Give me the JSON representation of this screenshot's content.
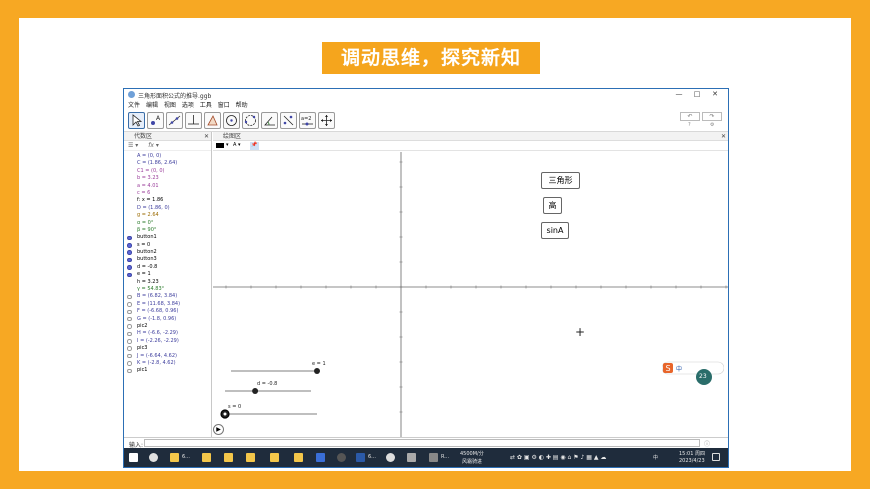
{
  "slide": {
    "title": "调动思维，探究新知"
  },
  "window": {
    "title": "三角形面积公式的推导.ggb",
    "controls": [
      "—",
      "□",
      "✕"
    ]
  },
  "menu": [
    "文件",
    "编辑",
    "视图",
    "选项",
    "工具",
    "窗口",
    "帮助"
  ],
  "algebra": {
    "header": "代数区",
    "fx": "fx",
    "items": [
      {
        "text": "A = (0, 0)",
        "color": "#3c3c9c",
        "dot": "none"
      },
      {
        "text": "C = (1.86, 2.64)",
        "color": "#3c3c9c",
        "dot": "none"
      },
      {
        "text": "C1 = (0, 0)",
        "color": "#9a3c9a",
        "dot": "none"
      },
      {
        "text": "b = 3.23",
        "color": "#9a3c9a",
        "dot": "none"
      },
      {
        "text": "a = 4.01",
        "color": "#9a3c9a",
        "dot": "none"
      },
      {
        "text": "c = 6",
        "color": "#9a3c9a",
        "dot": "none"
      },
      {
        "text": "f: x = 1.86",
        "color": "#000000",
        "dot": "none"
      },
      {
        "text": "D = (1.86, 0)",
        "color": "#3c3c9c",
        "dot": "none"
      },
      {
        "text": "g = 2.64",
        "color": "#9a6a00",
        "dot": "none"
      },
      {
        "text": "α = 0°",
        "color": "#2a7a2a",
        "dot": "none"
      },
      {
        "text": "β = 90°",
        "color": "#2a7a2a",
        "dot": "none"
      },
      {
        "text": "button1",
        "color": "#000000",
        "dot": "on"
      },
      {
        "text": "s = 0",
        "color": "#000000",
        "dot": "on"
      },
      {
        "text": "button2",
        "color": "#000000",
        "dot": "on"
      },
      {
        "text": "button3",
        "color": "#000000",
        "dot": "on"
      },
      {
        "text": "d = -0.8",
        "color": "#000000",
        "dot": "on"
      },
      {
        "text": "e = 1",
        "color": "#000000",
        "dot": "on"
      },
      {
        "text": "h = 3.23",
        "color": "#000000",
        "dot": "none"
      },
      {
        "text": "γ = 54.83°",
        "color": "#2a7a2a",
        "dot": "none"
      },
      {
        "text": "B = (6.82, 3.84)",
        "color": "#3c3c9c",
        "dot": "off"
      },
      {
        "text": "E = (11.68, 3.84)",
        "color": "#3c3c9c",
        "dot": "off"
      },
      {
        "text": "F = (-6.68, 0.96)",
        "color": "#3c3c9c",
        "dot": "off"
      },
      {
        "text": "G = (-1.8, 0.96)",
        "color": "#3c3c9c",
        "dot": "off"
      },
      {
        "text": "pic2",
        "color": "#000000",
        "dot": "off"
      },
      {
        "text": "H = (-6.6, -2.29)",
        "color": "#3c3c9c",
        "dot": "off"
      },
      {
        "text": "I = (-2.26, -2.29)",
        "color": "#3c3c9c",
        "dot": "off"
      },
      {
        "text": "pic3",
        "color": "#000000",
        "dot": "off"
      },
      {
        "text": "J = (-6.64, 4.62)",
        "color": "#3c3c9c",
        "dot": "off"
      },
      {
        "text": "K = (-2.8, 4.62)",
        "color": "#3c3c9c",
        "dot": "off"
      },
      {
        "text": "pic1",
        "color": "#000000",
        "dot": "off"
      }
    ]
  },
  "graphics": {
    "header": "绘图区",
    "buttons": [
      "三角形",
      "高",
      "sinA"
    ],
    "sliders": [
      {
        "label": "e = 1",
        "fraction": 1.0
      },
      {
        "label": "d = -0.8",
        "fraction": 0.35
      },
      {
        "label": "s = 0",
        "fraction": 0.0
      }
    ]
  },
  "input": {
    "label": "输入:"
  },
  "taskbar": {
    "items": [
      "6...",
      "6...",
      "R..."
    ],
    "network": "4500M/分",
    "network2": "风霜骑进",
    "time": "15:01 周四",
    "date": "2023/4/23",
    "lang": "中"
  },
  "ime": {
    "label": "中",
    "score": "23"
  }
}
